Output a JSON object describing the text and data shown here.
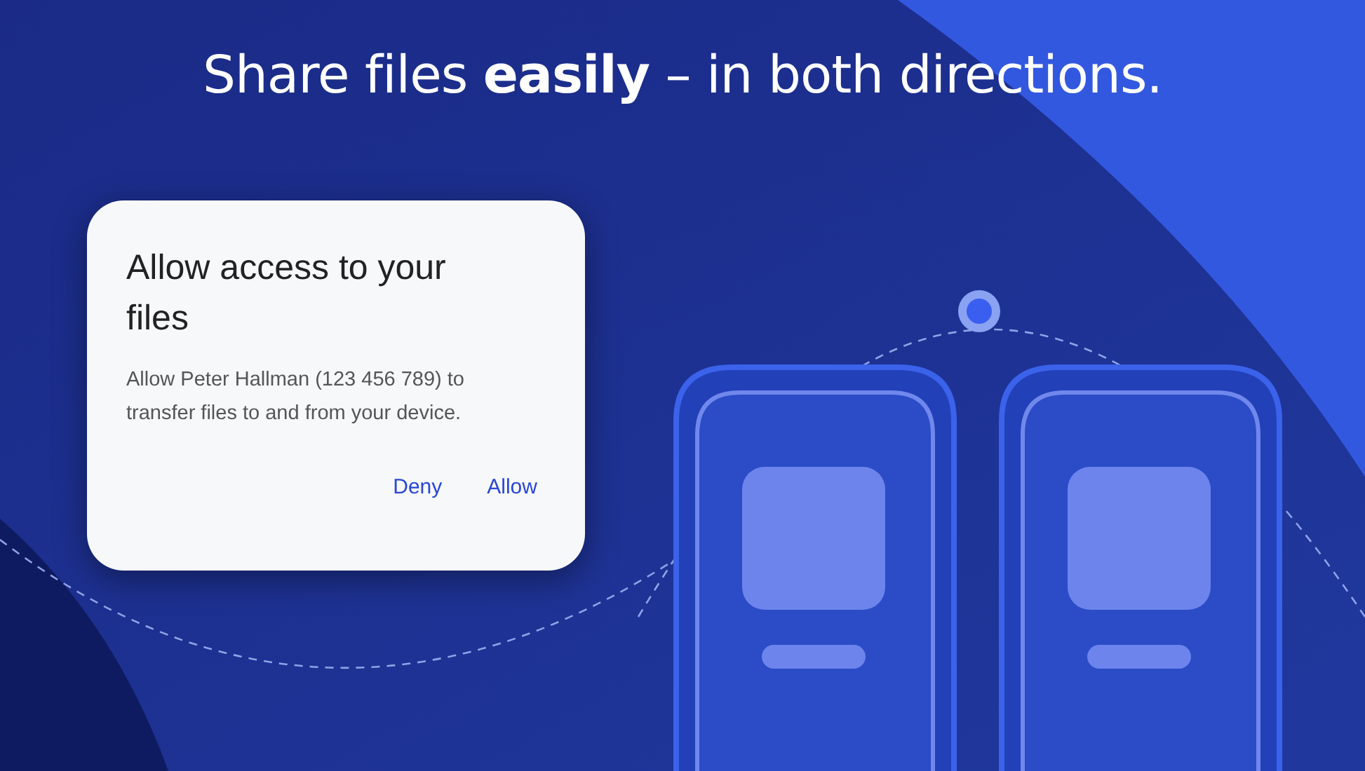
{
  "headline": "Share files **easily** – in both directions.",
  "dialog": {
    "title": "Allow access to your files",
    "message": "Allow Peter Hallman (123 456 789) to transfer files to and from your device.",
    "buttons": [
      {
        "label": "Deny"
      },
      {
        "label": "Allow"
      }
    ]
  }
}
